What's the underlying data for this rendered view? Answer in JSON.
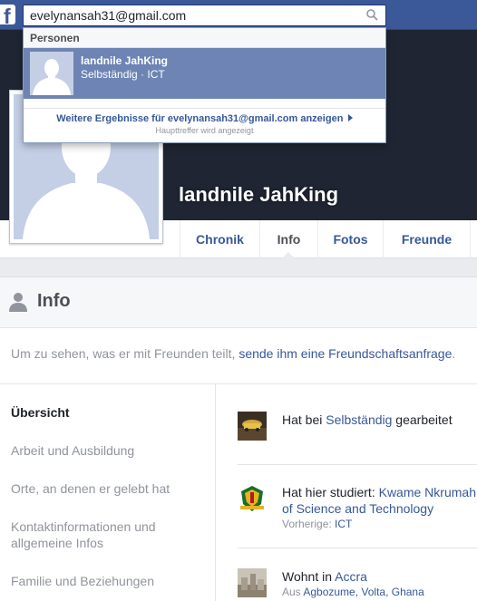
{
  "search": {
    "value": "evelynansah31@gmail.com"
  },
  "dropdown": {
    "section_header": "Personen",
    "result": {
      "name": "landnile JahKing",
      "meta": "Selbständig · ICT"
    },
    "more_results": "Weitere Ergebnisse für evelynansah31@gmail.com anzeigen",
    "more_hint": "Haupttreffer wird angezeigt"
  },
  "profile": {
    "name": "landnile JahKing"
  },
  "tabs": [
    {
      "label": "Chronik"
    },
    {
      "label": "Info"
    },
    {
      "label": "Fotos"
    },
    {
      "label": "Freunde"
    }
  ],
  "info": {
    "title": "Info",
    "notice_text": "Um zu sehen, was er mit Freunden teilt, ",
    "notice_link": "sende ihm eine Freundschaftsanfrage",
    "notice_end": "."
  },
  "nav": [
    {
      "label": "Übersicht"
    },
    {
      "label": "Arbeit und Ausbildung"
    },
    {
      "label": "Orte, an denen er gelebt hat"
    },
    {
      "label": "Kontaktinformationen und allgemeine Infos"
    },
    {
      "label": "Familie und Beziehungen"
    }
  ],
  "entries": {
    "work": {
      "prefix": "Hat bei ",
      "link": "Selbständig",
      "suffix": " gearbeitet"
    },
    "study": {
      "prefix": "Hat hier studiert: ",
      "link": "Kwame Nkrumah of Science and Technology",
      "sub_prefix": "Vorherige: ",
      "sub_link": "ICT"
    },
    "home": {
      "prefix": "Wohnt in ",
      "link": "Accra",
      "sub_prefix": "Aus ",
      "sub_link": "Agbozume, Volta, Ghana"
    }
  },
  "colors": {
    "brand": "#3b5998",
    "link": "#365899",
    "highlight": "#6d84b4"
  }
}
